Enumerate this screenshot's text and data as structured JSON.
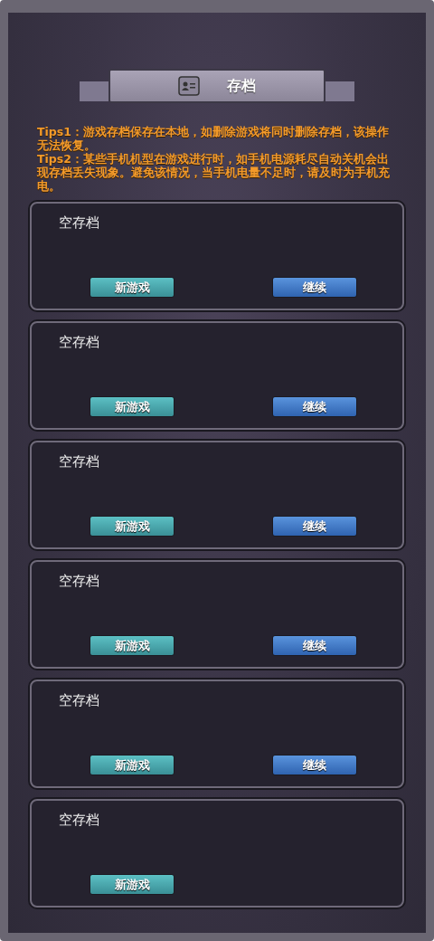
{
  "title": "存档",
  "tips": [
    "Tips1：游戏存档保存在本地，如删除游戏将同时删除存档，该操作无法恢复。",
    "Tips2：某些手机机型在游戏进行时，如手机电源耗尽自动关机会出现存档丢失现象。避免该情况，当手机电量不足时，请及时为手机充电。"
  ],
  "slots": [
    {
      "label": "空存档",
      "new_game": "新游戏",
      "continue": "继续"
    },
    {
      "label": "空存档",
      "new_game": "新游戏",
      "continue": "继续"
    },
    {
      "label": "空存档",
      "new_game": "新游戏",
      "continue": "继续"
    },
    {
      "label": "空存档",
      "new_game": "新游戏",
      "continue": "继续"
    },
    {
      "label": "空存档",
      "new_game": "新游戏",
      "continue": "继续"
    },
    {
      "label": "空存档",
      "new_game": "新游戏"
    }
  ]
}
